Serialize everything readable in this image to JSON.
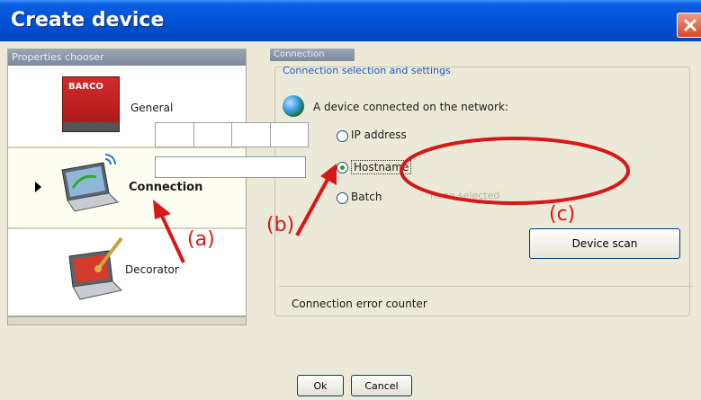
{
  "window": {
    "title": "Create device"
  },
  "left_pane": {
    "header": "Properties chooser",
    "items": [
      {
        "label": "General",
        "icon": "barco-logo-icon",
        "logo_text": "BARCO"
      },
      {
        "label": "Connection",
        "icon": "laptop-network-icon",
        "selected": true
      },
      {
        "label": "Decorator",
        "icon": "laptop-paint-icon"
      }
    ]
  },
  "right_pane": {
    "header": "Connection",
    "group_title": "Connection selection and settings",
    "network_label": "A device connected on the network:",
    "options": {
      "ip_address": {
        "label": "IP address",
        "checked": false
      },
      "hostname": {
        "label": "Hostname",
        "checked": true,
        "value": ""
      },
      "batch": {
        "label": "Batch",
        "checked": false,
        "hint": "none selected"
      }
    },
    "device_scan_label": "Device scan",
    "error_counter_label": "Connection error counter"
  },
  "buttons": {
    "ok": "Ok",
    "cancel": "Cancel"
  },
  "annotations": {
    "a": "(a)",
    "b": "(b)",
    "c": "(c)",
    "color": "#d81818"
  },
  "colors": {
    "titlebar": "#0250d4",
    "accent_text": "#1e5ac8",
    "close_button": "#d9481f"
  }
}
